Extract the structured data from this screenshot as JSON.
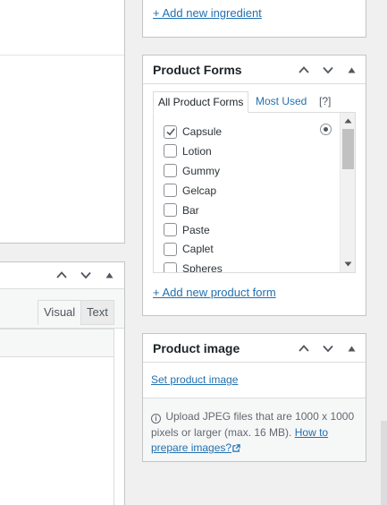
{
  "ingredients_box": {
    "add_link": "+ Add new ingredient"
  },
  "product_forms": {
    "title": "Product Forms",
    "tabs": [
      {
        "label": "All Product Forms",
        "active": true
      },
      {
        "label": "Most Used",
        "active": false
      },
      {
        "label": "[?]",
        "active": false
      }
    ],
    "items": [
      {
        "label": "Capsule",
        "checked": true
      },
      {
        "label": "Lotion",
        "checked": false
      },
      {
        "label": "Gummy",
        "checked": false
      },
      {
        "label": "Gelcap",
        "checked": false
      },
      {
        "label": "Bar",
        "checked": false
      },
      {
        "label": "Paste",
        "checked": false
      },
      {
        "label": "Caplet",
        "checked": false
      },
      {
        "label": "Spheres",
        "checked": false
      }
    ],
    "add_link": "+ Add new product form"
  },
  "editor": {
    "tabs": {
      "visual": "Visual",
      "text": "Text"
    }
  },
  "product_image": {
    "title": "Product image",
    "set_link": "Set product image",
    "info_text": "Upload JPEG files that are 1000 x 1000 pixels or larger (max. 16 MB).",
    "help_link": "How to prepare images?"
  },
  "colors": {
    "link": "#2271b1",
    "border": "#c3c4c7",
    "background": "#f0f0f1"
  },
  "icons": [
    "chevron-up-icon",
    "chevron-down-icon",
    "toggle-triangle-icon",
    "checkmark-icon",
    "radio-icon",
    "info-icon",
    "external-link-icon"
  ]
}
